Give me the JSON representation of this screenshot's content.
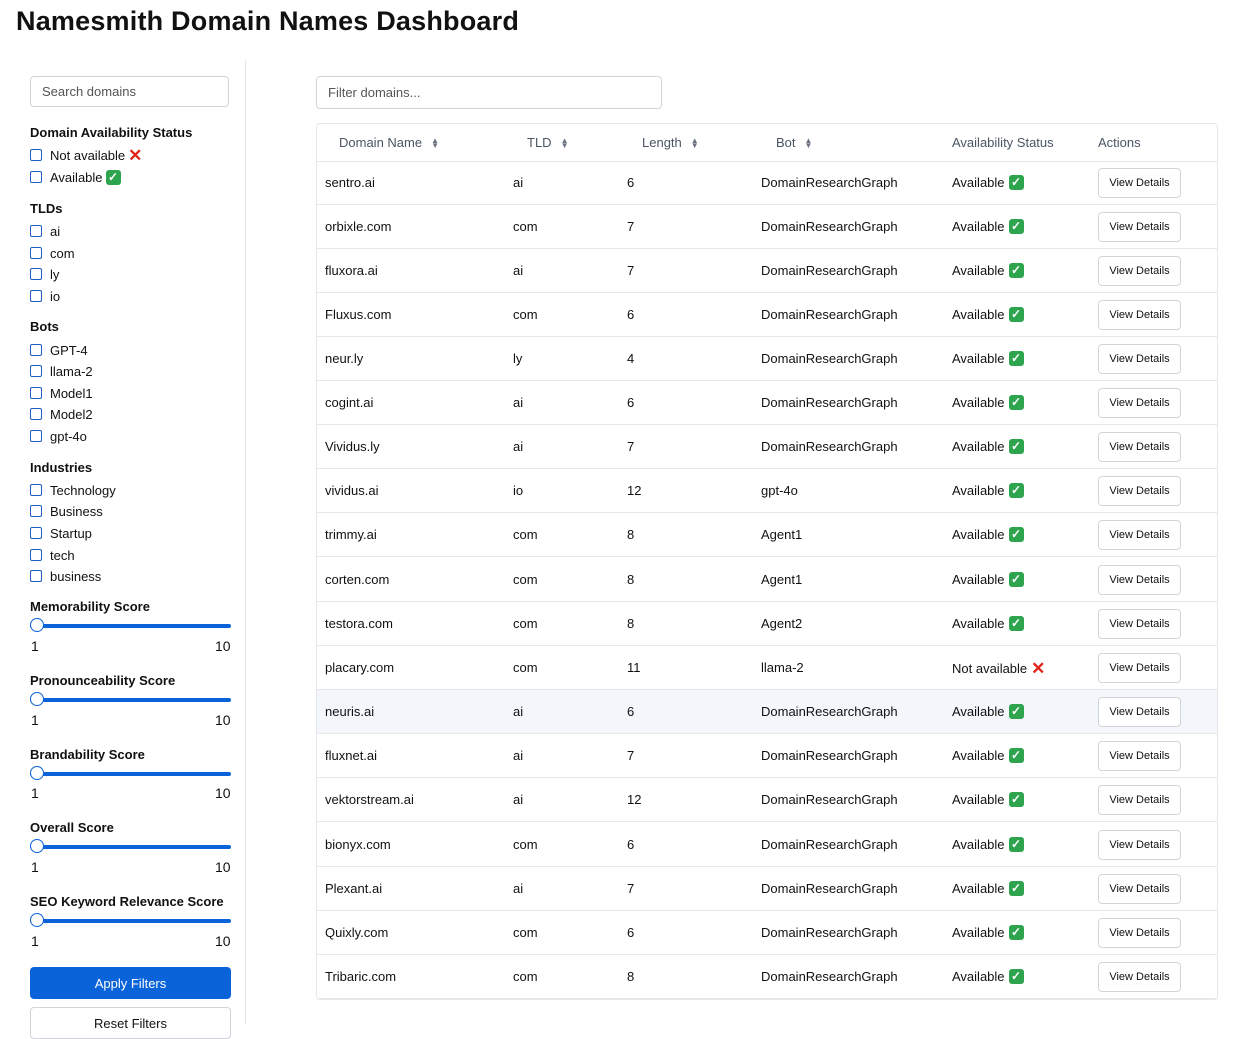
{
  "title": "Namesmith Domain Names Dashboard",
  "sidebar": {
    "search_placeholder": "Search domains",
    "availability": {
      "title": "Domain Availability Status",
      "options": [
        "Not available",
        "Available"
      ]
    },
    "tlds": {
      "title": "TLDs",
      "options": [
        "ai",
        "com",
        "ly",
        "io"
      ]
    },
    "bots": {
      "title": "Bots",
      "options": [
        "GPT-4",
        "llama-2",
        "Model1",
        "Model2",
        "gpt-4o"
      ]
    },
    "industries": {
      "title": "Industries",
      "options": [
        "Technology",
        "Business",
        "Startup",
        "tech",
        "business"
      ]
    },
    "scores": [
      {
        "title": "Memorability Score",
        "min": "1",
        "max": "10"
      },
      {
        "title": "Pronounceability Score",
        "min": "1",
        "max": "10"
      },
      {
        "title": "Brandability Score",
        "min": "1",
        "max": "10"
      },
      {
        "title": "Overall Score",
        "min": "1",
        "max": "10"
      },
      {
        "title": "SEO Keyword Relevance Score",
        "min": "1",
        "max": "10"
      }
    ],
    "apply_label": "Apply Filters",
    "reset_label": "Reset Filters"
  },
  "filter_placeholder": "Filter domains...",
  "table": {
    "headers": [
      "Domain Name",
      "TLD",
      "Length",
      "Bot",
      "Availability Status",
      "Actions"
    ],
    "action_label": "View Details",
    "rows": [
      {
        "domain": "sentro.ai",
        "tld": "ai",
        "length": "6",
        "bot": "DomainResearchGraph",
        "status": "Available",
        "ok": true
      },
      {
        "domain": "orbixle.com",
        "tld": "com",
        "length": "7",
        "bot": "DomainResearchGraph",
        "status": "Available",
        "ok": true
      },
      {
        "domain": "fluxora.ai",
        "tld": "ai",
        "length": "7",
        "bot": "DomainResearchGraph",
        "status": "Available",
        "ok": true
      },
      {
        "domain": "Fluxus.com",
        "tld": "com",
        "length": "6",
        "bot": "DomainResearchGraph",
        "status": "Available",
        "ok": true
      },
      {
        "domain": "neur.ly",
        "tld": "ly",
        "length": "4",
        "bot": "DomainResearchGraph",
        "status": "Available",
        "ok": true
      },
      {
        "domain": "cogint.ai",
        "tld": "ai",
        "length": "6",
        "bot": "DomainResearchGraph",
        "status": "Available",
        "ok": true
      },
      {
        "domain": "Vividus.ly",
        "tld": "ai",
        "length": "7",
        "bot": "DomainResearchGraph",
        "status": "Available",
        "ok": true
      },
      {
        "domain": "vividus.ai",
        "tld": "io",
        "length": "12",
        "bot": "gpt-4o",
        "status": "Available",
        "ok": true
      },
      {
        "domain": "trimmy.ai",
        "tld": "com",
        "length": "8",
        "bot": "Agent1",
        "status": "Available",
        "ok": true
      },
      {
        "domain": "corten.com",
        "tld": "com",
        "length": "8",
        "bot": "Agent1",
        "status": "Available",
        "ok": true
      },
      {
        "domain": "testora.com",
        "tld": "com",
        "length": "8",
        "bot": "Agent2",
        "status": "Available",
        "ok": true
      },
      {
        "domain": "placary.com",
        "tld": "com",
        "length": "11",
        "bot": "llama-2",
        "status": "Not available",
        "ok": false
      },
      {
        "domain": "neuris.ai",
        "tld": "ai",
        "length": "6",
        "bot": "DomainResearchGraph",
        "status": "Available",
        "ok": true,
        "highlighted": true
      },
      {
        "domain": "fluxnet.ai",
        "tld": "ai",
        "length": "7",
        "bot": "DomainResearchGraph",
        "status": "Available",
        "ok": true
      },
      {
        "domain": "vektorstream.ai",
        "tld": "ai",
        "length": "12",
        "bot": "DomainResearchGraph",
        "status": "Available",
        "ok": true
      },
      {
        "domain": "bionyx.com",
        "tld": "com",
        "length": "6",
        "bot": "DomainResearchGraph",
        "status": "Available",
        "ok": true
      },
      {
        "domain": "Plexant.ai",
        "tld": "ai",
        "length": "7",
        "bot": "DomainResearchGraph",
        "status": "Available",
        "ok": true
      },
      {
        "domain": "Quixly.com",
        "tld": "com",
        "length": "6",
        "bot": "DomainResearchGraph",
        "status": "Available",
        "ok": true
      },
      {
        "domain": "Tribaric.com",
        "tld": "com",
        "length": "8",
        "bot": "DomainResearchGraph",
        "status": "Available",
        "ok": true
      }
    ]
  },
  "colors": {
    "primary": "#0a63d8",
    "available": "#2ea44f",
    "unavailable": "#e0251b",
    "highlight_row": "#f3f6fa"
  }
}
